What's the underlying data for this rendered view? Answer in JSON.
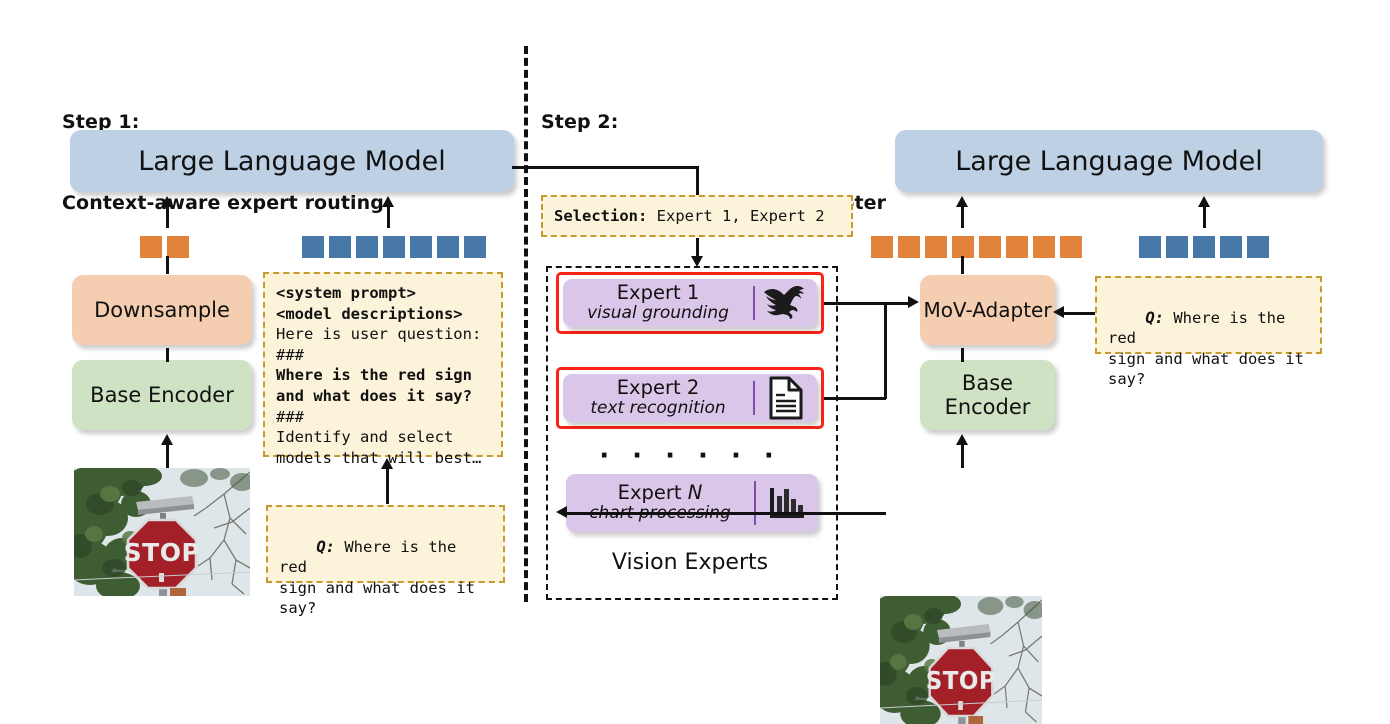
{
  "steps": {
    "left": {
      "line1": "Step 1:",
      "line2": "Context-aware expert routing"
    },
    "right": {
      "line1": "Step 2:",
      "line2": "Expert fusion with MoV-Adapter"
    }
  },
  "left_column": {
    "llm_label": "Large Language Model",
    "downsample_label": "Downsample",
    "encoder_label": "Base Encoder",
    "vision_tokens": {
      "color": "#e2833c",
      "count": 2
    },
    "text_tokens": {
      "color": "#4878a8",
      "count": 7
    },
    "prompt_note": {
      "lines": [
        {
          "text": "<system prompt>",
          "bold": true
        },
        {
          "text": "<model descriptions>",
          "bold": true
        },
        {
          "text": "Here is user question:",
          "bold": false
        },
        {
          "text": "###",
          "bold": false
        },
        {
          "text": "Where is the red sign",
          "bold": true
        },
        {
          "text": "and what does it say?",
          "bold": true
        },
        {
          "text": "###",
          "bold": false
        },
        {
          "text": "Identify and select",
          "bold": false
        },
        {
          "text": "models that will best…",
          "bold": false
        }
      ]
    },
    "question_note": {
      "label": "Q:",
      "text": " Where is the red\nsign and what does it\nsay?"
    },
    "image_alt": "stop-sign-photo"
  },
  "middle_column": {
    "selection_note": {
      "label": "Selection:",
      "text": " Expert 1, Expert 2"
    },
    "experts": [
      {
        "name": "Expert 1",
        "skill": "visual grounding",
        "icon": "eagle-icon",
        "selected": true
      },
      {
        "name": "Expert 2",
        "skill": "text recognition",
        "icon": "document-icon",
        "selected": true
      },
      {
        "name": "Expert N",
        "skill": "chart processing",
        "icon": "bar-chart-icon",
        "selected": false
      }
    ],
    "ellipsis": "· · · · · ·",
    "group_label": "Vision Experts"
  },
  "right_column": {
    "llm_label": "Large Language Model",
    "adapter_label": "MoV-Adapter",
    "encoder_label": "Base Encoder",
    "vision_tokens": {
      "color": "#e2833c",
      "count": 8
    },
    "text_tokens": {
      "color": "#4878a8",
      "count": 5
    },
    "question_note": {
      "label": "Q:",
      "text": " Where is the red\nsign and what does it\nsay?"
    },
    "image_alt": "stop-sign-photo"
  },
  "colors": {
    "llm": "#bed0e4",
    "adapter": "#f5cdb0",
    "encoder": "#cfe3c4",
    "expert": "#d9c6e8",
    "note_bg": "#fbf3da",
    "note_border": "#c79a2e",
    "highlight": "#fa2414",
    "vision_token": "#e2833c",
    "text_token": "#4878a8"
  }
}
